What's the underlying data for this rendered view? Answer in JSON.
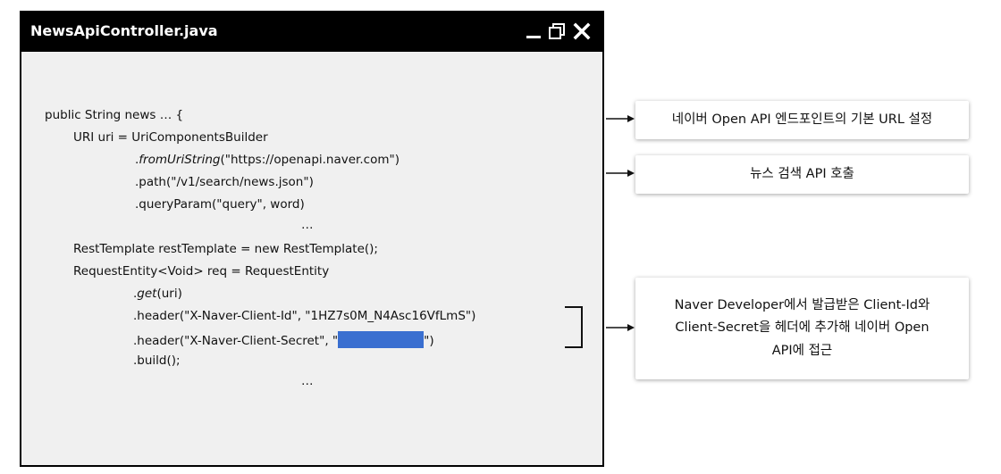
{
  "window": {
    "title": "NewsApiController.java"
  },
  "code": {
    "line1": "public String news … {",
    "line2": "URI uri = UriComponentsBuilder",
    "line3_dot": ".",
    "line3_method": "fromUriString",
    "line3_args": "(\"https://openapi.naver.com\")",
    "line4": ".path(\"/v1/search/news.json\")",
    "line5": ".queryParam(\"query\", word)",
    "line6": "…",
    "line7": "RestTemplate restTemplate = new RestTemplate();",
    "line8": "RequestEntity<Void> req = RequestEntity",
    "line9_dot": ".",
    "line9_method": "get",
    "line9_args": "(uri)",
    "line10": ".header(\"X-Naver-Client-Id\", \"1HZ7s0M_N4Asc16VfLmS\")",
    "line11_prefix": ".header(\"X-Naver-Client-Secret\", \"",
    "line11_suffix": "\")",
    "line12": ".build();",
    "line13": "…",
    "redaction_color": "#3a6fd0"
  },
  "callouts": {
    "c1": "네이버 Open API 엔드포인트의 기본 URL 설정",
    "c2": "뉴스 검색 API 호출",
    "c3_line1": "Naver Developer에서 발급받은 Client-Id와",
    "c3_line2": "Client-Secret을 헤더에 추가해 네이버 Open",
    "c3_line3": "API에 접근"
  }
}
